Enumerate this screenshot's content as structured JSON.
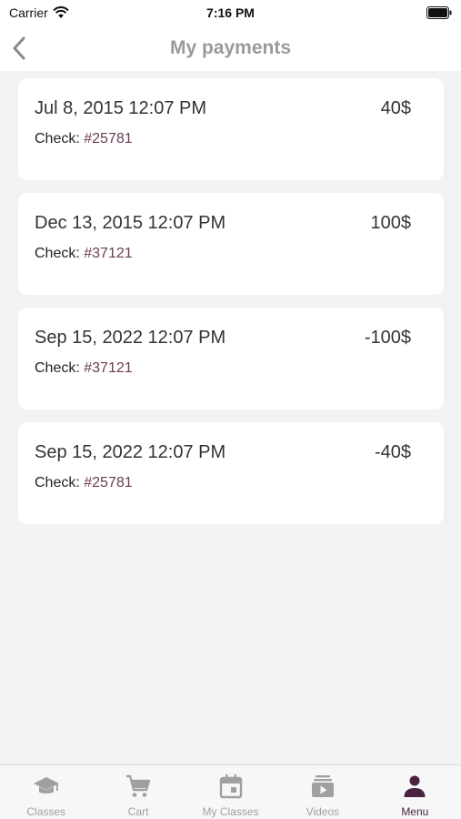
{
  "status_bar": {
    "carrier": "Carrier",
    "time": "7:16 PM"
  },
  "header": {
    "title": "My payments",
    "back_icon": "chevron-left-icon"
  },
  "payments": [
    {
      "date": "Jul 8, 2015 12:07 PM",
      "amount": "40$",
      "check_label": "Check:",
      "check_number": "#25781"
    },
    {
      "date": "Dec 13, 2015 12:07 PM",
      "amount": "100$",
      "check_label": "Check:",
      "check_number": "#37121"
    },
    {
      "date": "Sep 15, 2022 12:07 PM",
      "amount": "-100$",
      "check_label": "Check:",
      "check_number": "#37121"
    },
    {
      "date": "Sep 15, 2022 12:07 PM",
      "amount": "-40$",
      "check_label": "Check:",
      "check_number": "#25781"
    }
  ],
  "tabbar": {
    "tabs": [
      {
        "label": "Classes",
        "icon": "graduation-cap-icon",
        "active": false
      },
      {
        "label": "Cart",
        "icon": "cart-icon",
        "active": false
      },
      {
        "label": "My Classes",
        "icon": "calendar-icon",
        "active": false
      },
      {
        "label": "Videos",
        "icon": "video-library-icon",
        "active": false
      },
      {
        "label": "Menu",
        "icon": "person-icon",
        "active": true
      }
    ]
  },
  "colors": {
    "accent": "#4a2340",
    "check_number": "#6b3b55",
    "inactive_tab": "#a0a0a0",
    "title": "#9a9a9a"
  }
}
